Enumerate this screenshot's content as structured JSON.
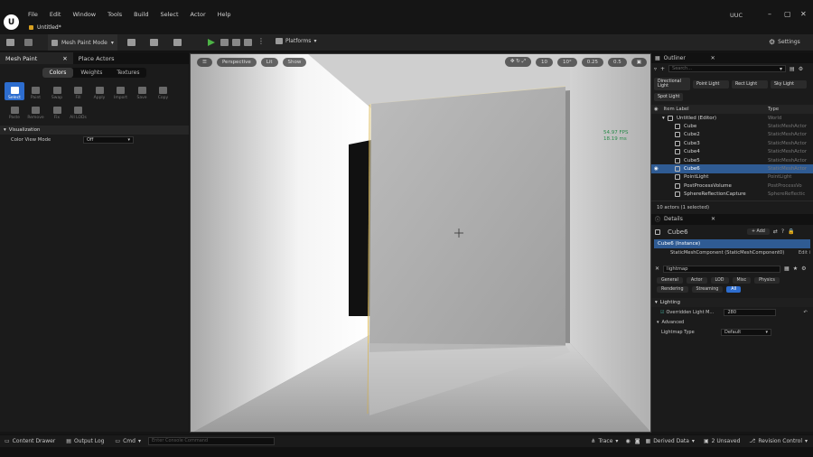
{
  "app": {
    "logo": "U",
    "user": "UUC",
    "document_tab": "Untitled*"
  },
  "menu": [
    "File",
    "Edit",
    "Window",
    "Tools",
    "Build",
    "Select",
    "Actor",
    "Help"
  ],
  "window_controls": {
    "min": "–",
    "max": "▢",
    "close": "✕"
  },
  "toolbar": {
    "mode": "Mesh Paint Mode",
    "platforms": "Platforms",
    "settings": "Settings"
  },
  "left_panel": {
    "tabs": [
      "Mesh Paint",
      "Place Actors"
    ],
    "paint_tabs": [
      "Colors",
      "Weights",
      "Textures"
    ],
    "tools_row1": [
      "Select",
      "Paint",
      "Swap",
      "Fill",
      "Apply",
      "Import",
      "Save",
      "Copy"
    ],
    "tools_row2": [
      "Paste",
      "Remove",
      "Fix",
      "All LODs"
    ],
    "section": "Visualization",
    "color_view_mode_label": "Color View Mode",
    "color_view_mode_value": "Off"
  },
  "viewport": {
    "perspective": "Perspective",
    "lit": "Lit",
    "show": "Show",
    "fps_line1": "54.97 FPS",
    "fps_line2": "18.19 ms",
    "grid": "10",
    "angle": "10°",
    "scale": "0.25",
    "speed": "0.5"
  },
  "outliner": {
    "title": "Outliner",
    "search_placeholder": "Search...",
    "quick_add": [
      "Directional Light",
      "Point Light",
      "Rect Light",
      "Sky Light",
      "Spot Light"
    ],
    "col_label": "Item Label",
    "col_type": "Type",
    "items": [
      {
        "label": "Untitled (Editor)",
        "type": "World",
        "indent": 1,
        "selected": false
      },
      {
        "label": "Cube",
        "type": "StaticMeshActor",
        "indent": 2,
        "selected": false
      },
      {
        "label": "Cube2",
        "type": "StaticMeshActor",
        "indent": 2,
        "selected": false
      },
      {
        "label": "Cube3",
        "type": "StaticMeshActor",
        "indent": 2,
        "selected": false
      },
      {
        "label": "Cube4",
        "type": "StaticMeshActor",
        "indent": 2,
        "selected": false
      },
      {
        "label": "Cube5",
        "type": "StaticMeshActor",
        "indent": 2,
        "selected": false
      },
      {
        "label": "Cube6",
        "type": "StaticMeshActor",
        "indent": 2,
        "selected": true
      },
      {
        "label": "PointLight",
        "type": "PointLight",
        "indent": 2,
        "selected": false
      },
      {
        "label": "PostProcessVolume",
        "type": "PostProcessVo",
        "indent": 2,
        "selected": false
      },
      {
        "label": "SphereReflectionCapture",
        "type": "SphereReflectic",
        "indent": 2,
        "selected": false
      }
    ],
    "count": "10 actors (1 selected)"
  },
  "details": {
    "title": "Details",
    "actor": "Cube6",
    "add": "+ Add",
    "instance": "Cube6 (Instance)",
    "component": "StaticMeshComponent (StaticMeshComponent0)",
    "edit": "Edit i",
    "search_value": "lightmap",
    "filters_row1": [
      "General",
      "Actor",
      "LOD",
      "Misc",
      "Physics"
    ],
    "filters_row2": [
      "Rendering",
      "Streaming",
      "All"
    ],
    "lighting": "Lighting",
    "overridden_label": "Overridden Light M...",
    "overridden_value": "280",
    "advanced": "Advanced",
    "lightmap_type_label": "Lightmap Type",
    "lightmap_type_value": "Default"
  },
  "statusbar": {
    "content_drawer": "Content Drawer",
    "output_log": "Output Log",
    "cmd": "Cmd",
    "console_placeholder": "Enter Console Command",
    "trace": "Trace",
    "derived_data": "Derived Data",
    "unsaved": "2 Unsaved",
    "revision": "Revision Control"
  }
}
